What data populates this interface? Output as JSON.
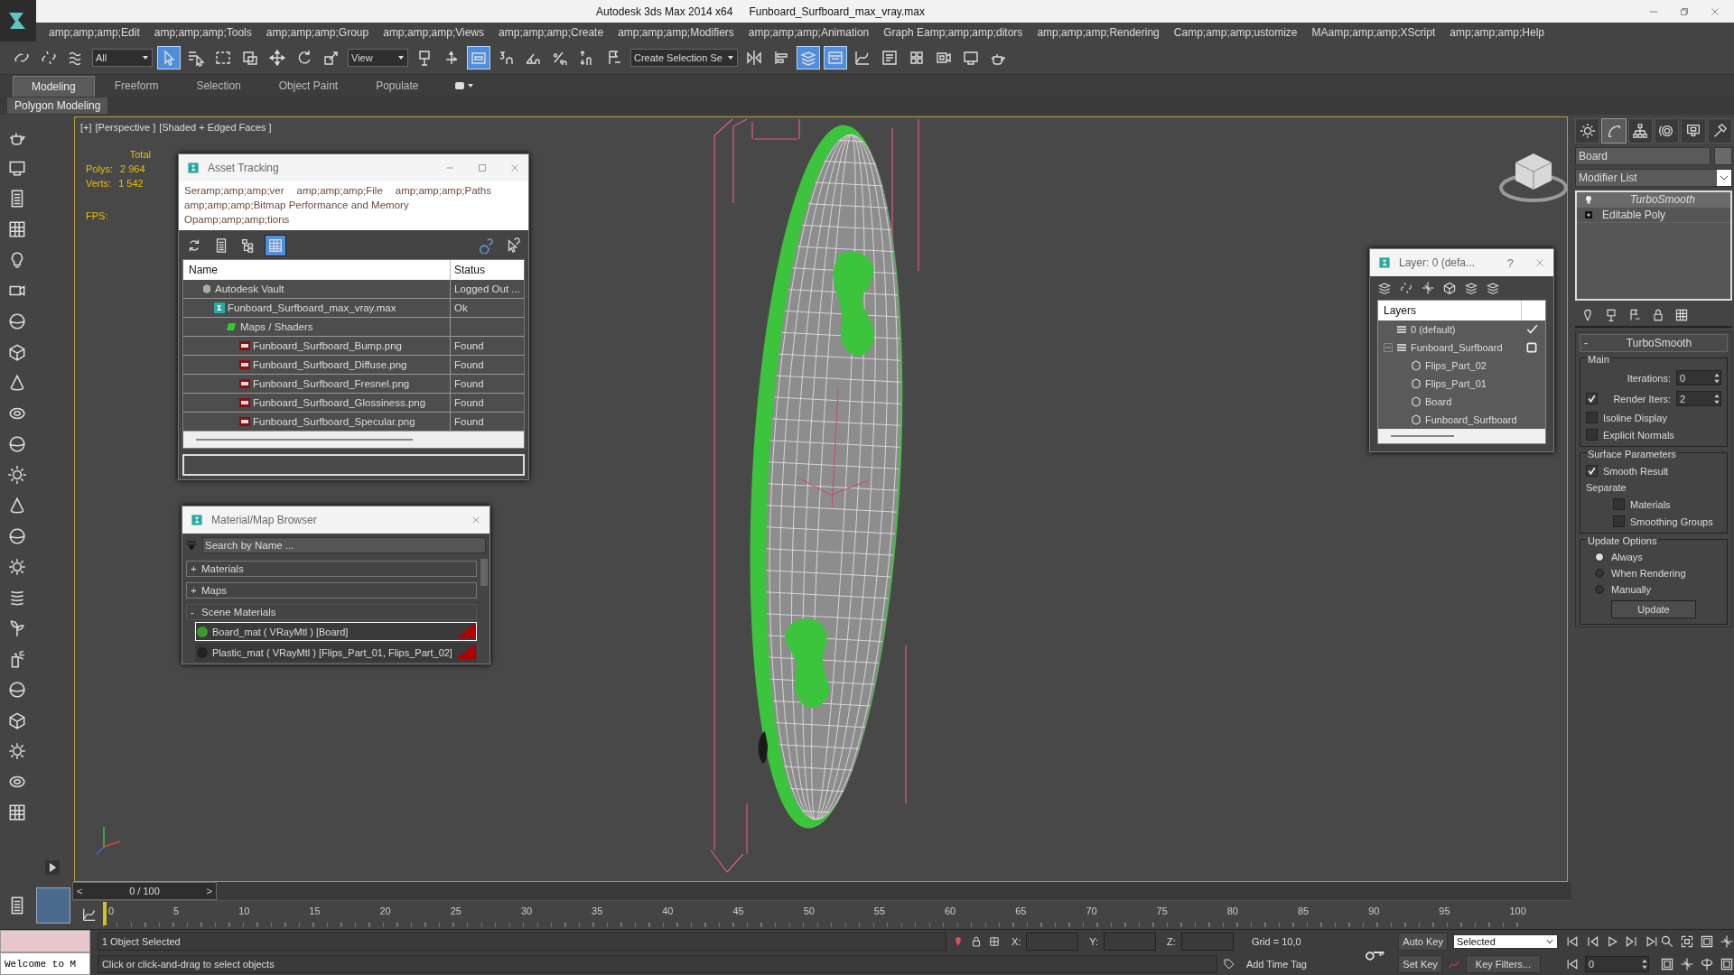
{
  "title_bar": {
    "app": "Autodesk 3ds Max  2014 x64",
    "file": "Funboard_Surfboard_max_vray.max"
  },
  "menu": [
    "amp;amp;amp;Edit",
    "amp;amp;amp;Tools",
    "amp;amp;amp;Group",
    "amp;amp;amp;Views",
    "amp;amp;amp;Create",
    "amp;amp;amp;Modifiers",
    "amp;amp;amp;Animation",
    "Graph Eamp;amp;amp;ditors",
    "amp;amp;amp;Rendering",
    "Camp;amp;amp;ustomize",
    "MAamp;amp;amp;XScript",
    "amp;amp;amp;Help"
  ],
  "toolbar": [
    {
      "kind": "chain-link",
      "selected": false
    },
    {
      "kind": "broken-link",
      "selected": false
    },
    {
      "kind": "wave",
      "selected": false
    },
    {
      "kind": "dropdown",
      "value": "All"
    },
    {
      "kind": "cursor",
      "selected": true
    },
    {
      "kind": "cursor-list",
      "selected": false
    },
    {
      "kind": "dashed-rectangle",
      "selected": false
    },
    {
      "kind": "overlap-rectangles",
      "selected": false
    },
    {
      "kind": "move",
      "selected": false
    },
    {
      "kind": "rotate",
      "selected": false
    },
    {
      "kind": "scale",
      "selected": false
    },
    {
      "kind": "dropdown",
      "value": "View"
    },
    {
      "kind": "pivot",
      "selected": false
    },
    {
      "kind": "manipulator",
      "selected": false
    },
    {
      "kind": "keyboard",
      "selected": true
    },
    {
      "kind": "snap",
      "selected": false
    },
    {
      "kind": "angle-snap",
      "selected": false
    },
    {
      "kind": "percent-snap",
      "selected": false
    },
    {
      "kind": "spinner-snap",
      "selected": false
    },
    {
      "kind": "flag",
      "selected": false
    },
    {
      "kind": "dropdown",
      "value": "Create Selection Se"
    },
    {
      "kind": "mirror",
      "selected": false
    },
    {
      "kind": "align",
      "selected": false
    },
    {
      "kind": "layers",
      "selected": true
    },
    {
      "kind": "ribbon",
      "selected": true
    },
    {
      "kind": "curve-editor",
      "selected": false
    },
    {
      "kind": "schematic",
      "selected": false
    },
    {
      "kind": "material",
      "selected": false
    },
    {
      "kind": "render-setup",
      "selected": false
    },
    {
      "kind": "render-frame",
      "selected": false
    },
    {
      "kind": "teapot",
      "selected": false
    }
  ],
  "ribbon": {
    "tabs": [
      {
        "label": "Modeling",
        "selected": true
      },
      {
        "label": "Freeform",
        "selected": false
      },
      {
        "label": "Selection",
        "selected": false
      },
      {
        "label": "Object Paint",
        "selected": false
      },
      {
        "label": "Populate",
        "selected": false
      }
    ],
    "panel": "Polygon Modeling"
  },
  "viewport": {
    "labels": [
      "[+]",
      "[Perspective ]",
      "[Shaded + Edged Faces ]"
    ],
    "total": "Total",
    "stats": [
      {
        "label": "Polys:",
        "value": "2 964"
      },
      {
        "label": "Verts:",
        "value": "1 542"
      }
    ],
    "fps": "FPS:"
  },
  "asset_tracking": {
    "title": "Asset Tracking",
    "menu": [
      "Seramp;amp;amp;ver",
      "amp;amp;amp;File",
      "amp;amp;amp;Paths",
      "amp;amp;amp;Bitmap Performance and Memory",
      "Opamp;amp;amp;tions"
    ],
    "toolbar": [
      {
        "kind": "refresh",
        "selected": false
      },
      {
        "kind": "document",
        "selected": false
      },
      {
        "kind": "tree",
        "selected": false
      },
      {
        "kind": "table",
        "selected": true
      }
    ],
    "columns": [
      "Name",
      "Status"
    ],
    "rows": [
      {
        "kind": "vault",
        "name": "Autodesk Vault",
        "status": "Logged Out ...",
        "children": [
          {
            "kind": "max",
            "name": "Funboard_Surfboard_max_vray.max",
            "status": "Ok",
            "children": [
              {
                "kind": "maps",
                "name": "Maps / Shaders",
                "children": [
                  {
                    "kind": "png",
                    "name": "Funboard_Surfboard_Bump.png",
                    "status": "Found"
                  },
                  {
                    "kind": "png",
                    "name": "Funboard_Surfboard_Diffuse.png",
                    "status": "Found"
                  },
                  {
                    "kind": "png",
                    "name": "Funboard_Surfboard_Fresnel.png",
                    "status": "Found"
                  },
                  {
                    "kind": "png",
                    "name": "Funboard_Surfboard_Glossiness.png",
                    "status": "Found"
                  },
                  {
                    "kind": "png",
                    "name": "Funboard_Surfboard_Specular.png",
                    "status": "Found"
                  }
                ]
              }
            ]
          }
        ]
      }
    ]
  },
  "material_browser": {
    "title": "Material/Map Browser",
    "search": {
      "placeholder": "Search by Name ..."
    },
    "groups": [
      {
        "toggle": "+",
        "label": "Materials",
        "expanded": false
      },
      {
        "toggle": "+",
        "label": "Maps",
        "expanded": false
      },
      {
        "toggle": "-",
        "label": "Scene Materials",
        "expanded": true,
        "items": [
          {
            "label": "Board_mat ( VRayMtl ) [Board]",
            "color": "#3a9a2a",
            "selected": true
          },
          {
            "label": "Plastic_mat ( VRayMtl ) [Flips_Part_01, Flips_Part_02]",
            "color": "#222222",
            "selected": false
          }
        ]
      }
    ]
  },
  "layer_explorer": {
    "title": "Layer: 0 (defa...",
    "help": "?",
    "column": "Layers",
    "layers": [
      {
        "name": "0 (default)",
        "current": true
      },
      {
        "name": "Funboard_Surfboard",
        "current": false,
        "expanded": true,
        "children": [
          {
            "name": "Flips_Part_02"
          },
          {
            "name": "Flips_Part_01"
          },
          {
            "name": "Board"
          },
          {
            "name": "Funboard_Surfboard"
          }
        ]
      }
    ]
  },
  "command_panel": {
    "tabs": [
      {
        "kind": "sun",
        "selected": false
      },
      {
        "kind": "bent-arc",
        "selected": true
      },
      {
        "kind": "hierarchy",
        "selected": false
      },
      {
        "kind": "target",
        "selected": false
      },
      {
        "kind": "monitor",
        "selected": false
      },
      {
        "kind": "hammer",
        "selected": false
      }
    ],
    "object_name": "Board",
    "modifier_list": "Modifier List",
    "stack": [
      {
        "kind": "modifier",
        "label": "TurboSmooth",
        "selected": true
      },
      {
        "kind": "base",
        "label": "Editable Poly",
        "selected": false
      }
    ],
    "rollout": {
      "toggle": "-",
      "title": "TurboSmooth",
      "groups": [
        {
          "title": "Main",
          "controls": [
            {
              "kind": "spinner",
              "label": "Iterations:",
              "value": "0"
            },
            {
              "kind": "spinner",
              "label": "Render Iters:",
              "value": "2",
              "checked": true
            },
            {
              "kind": "checkbox",
              "label": "Isoline Display",
              "checked": false
            },
            {
              "kind": "checkbox",
              "label": "Explicit Normals",
              "checked": false
            }
          ]
        },
        {
          "title": "Surface Parameters",
          "controls": [
            {
              "kind": "checkbox",
              "label": "Smooth Result",
              "checked": true
            },
            {
              "kind": "text",
              "label": "Separate"
            },
            {
              "kind": "subcheckbox",
              "label": "Materials",
              "checked": false
            },
            {
              "kind": "subcheckbox",
              "label": "Smoothing Groups",
              "checked": false
            }
          ]
        },
        {
          "title": "Update Options",
          "controls": [
            {
              "kind": "radio",
              "label": "Always",
              "selected": true
            },
            {
              "kind": "radio",
              "label": "When Rendering",
              "selected": false
            },
            {
              "kind": "radio",
              "label": "Manually",
              "selected": false
            },
            {
              "kind": "button",
              "label": "Update"
            }
          ]
        }
      ]
    }
  },
  "timeline": {
    "prev": "<",
    "frame": "0 / 100",
    "next": ">",
    "level": 0,
    "ticks": [
      "0",
      "5",
      "10",
      "15",
      "20",
      "25",
      "30",
      "35",
      "40",
      "45",
      "50",
      "55",
      "60",
      "65",
      "70",
      "75",
      "80",
      "85",
      "90",
      "95",
      "100"
    ]
  },
  "status_bar": {
    "listener": "Welcome to M",
    "selection": "1 Object Selected",
    "prompt": "Click or click-and-drag to select objects",
    "coords": [
      "X:",
      "Y:",
      "Z:"
    ],
    "grid": "Grid = 10,0",
    "add_time_tag": "Add Time Tag",
    "auto_key": "Auto Key",
    "key_mode": "Selected",
    "set_key": "Set Key",
    "key_filters": "Key Filters...",
    "current_frame": "0"
  }
}
